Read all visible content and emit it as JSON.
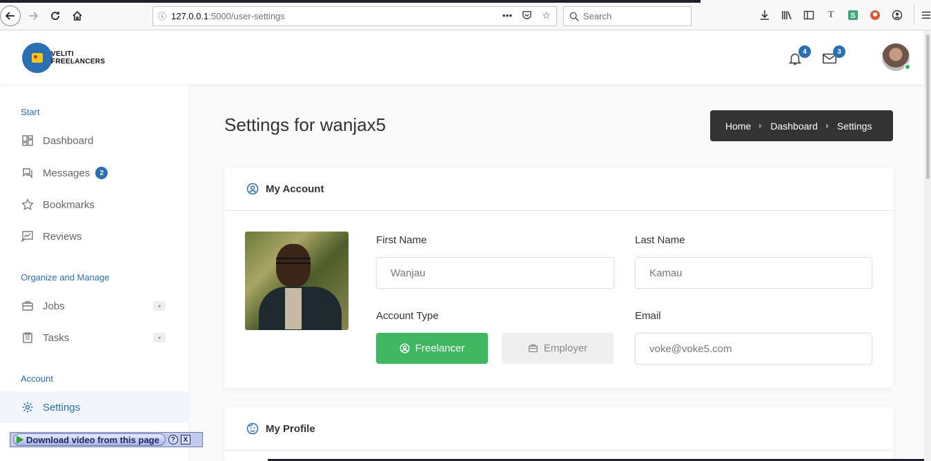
{
  "browser": {
    "url_host": "127.0.0.1",
    "url_path": ":5000/user-settings",
    "search_placeholder": "Search"
  },
  "header": {
    "logo_line1": "VELITI",
    "logo_line2": "FREELANCERS",
    "notifications_count": "4",
    "messages_count": "3"
  },
  "sidebar": {
    "sections": {
      "start": "Start",
      "organize": "Organize and Manage",
      "account": "Account"
    },
    "items": {
      "dashboard": "Dashboard",
      "messages": "Messages",
      "messages_badge": "2",
      "bookmarks": "Bookmarks",
      "reviews": "Reviews",
      "jobs": "Jobs",
      "tasks": "Tasks",
      "settings": "Settings"
    }
  },
  "main": {
    "title": "Settings for wanjax5",
    "breadcrumb": [
      "Home",
      "Dashboard",
      "Settings"
    ]
  },
  "account_card": {
    "heading": "My Account",
    "first_name_label": "First Name",
    "first_name_value": "Wanjau",
    "last_name_label": "Last Name",
    "last_name_value": "Kamau",
    "account_type_label": "Account Type",
    "freelancer_label": "Freelancer",
    "employer_label": "Employer",
    "email_label": "Email",
    "email_value": "voke@voke5.com"
  },
  "profile_card": {
    "heading": "My Profile"
  },
  "download_plugin": {
    "label": "Download video from this page",
    "help": "?",
    "close": "X"
  },
  "colors": {
    "accent": "#2a6fb4",
    "success": "#3fb760",
    "breadcrumb_bg": "#333333"
  }
}
